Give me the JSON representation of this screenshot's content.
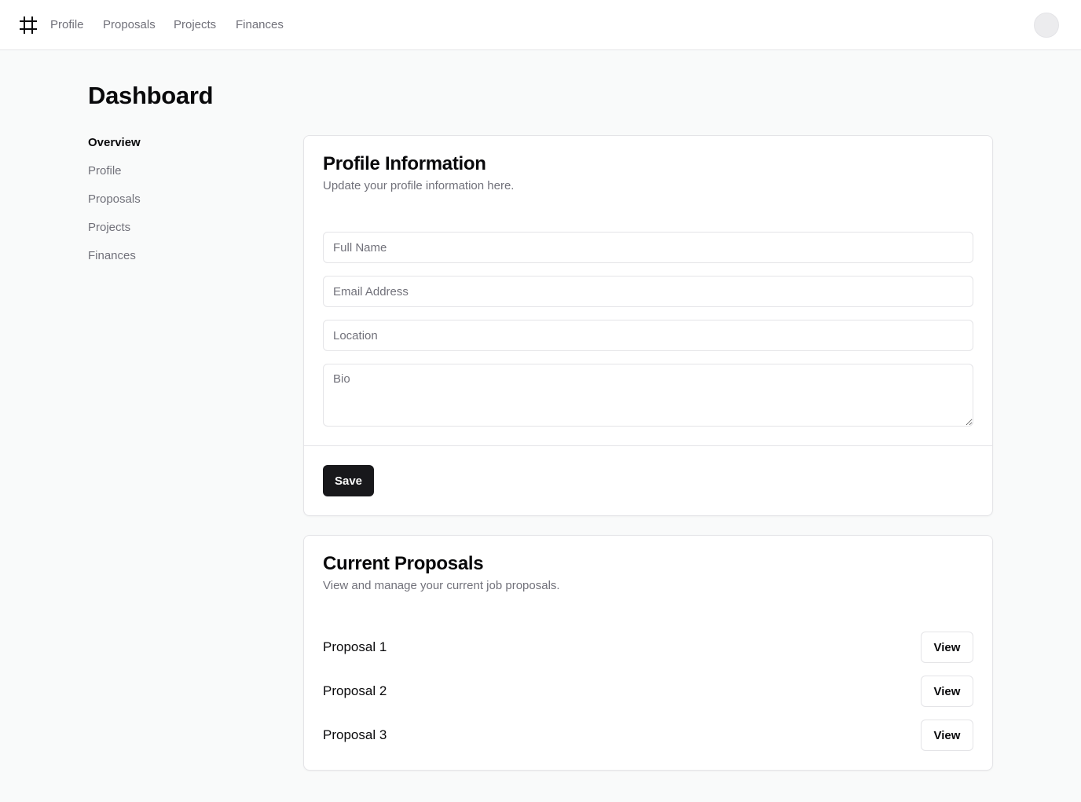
{
  "topbar": {
    "logo_icon": "hash-icon",
    "nav": [
      "Profile",
      "Proposals",
      "Projects",
      "Finances"
    ]
  },
  "page": {
    "title": "Dashboard"
  },
  "sidebar": {
    "items": [
      "Overview",
      "Profile",
      "Proposals",
      "Projects",
      "Finances"
    ],
    "active": "Overview"
  },
  "profile_card": {
    "title": "Profile Information",
    "description": "Update your profile information here.",
    "fields": {
      "full_name": {
        "placeholder": "Full Name",
        "value": ""
      },
      "email": {
        "placeholder": "Email Address",
        "value": ""
      },
      "location": {
        "placeholder": "Location",
        "value": ""
      },
      "bio": {
        "placeholder": "Bio",
        "value": ""
      }
    },
    "save_label": "Save"
  },
  "proposals_card": {
    "title": "Current Proposals",
    "description": "View and manage your current job proposals.",
    "items": [
      {
        "name": "Proposal 1",
        "action": "View"
      },
      {
        "name": "Proposal 2",
        "action": "View"
      },
      {
        "name": "Proposal 3",
        "action": "View"
      }
    ]
  },
  "colors": {
    "primary": "#18181b",
    "muted_text": "#71717a",
    "border": "#e4e4e7",
    "background": "#f9fafa"
  }
}
